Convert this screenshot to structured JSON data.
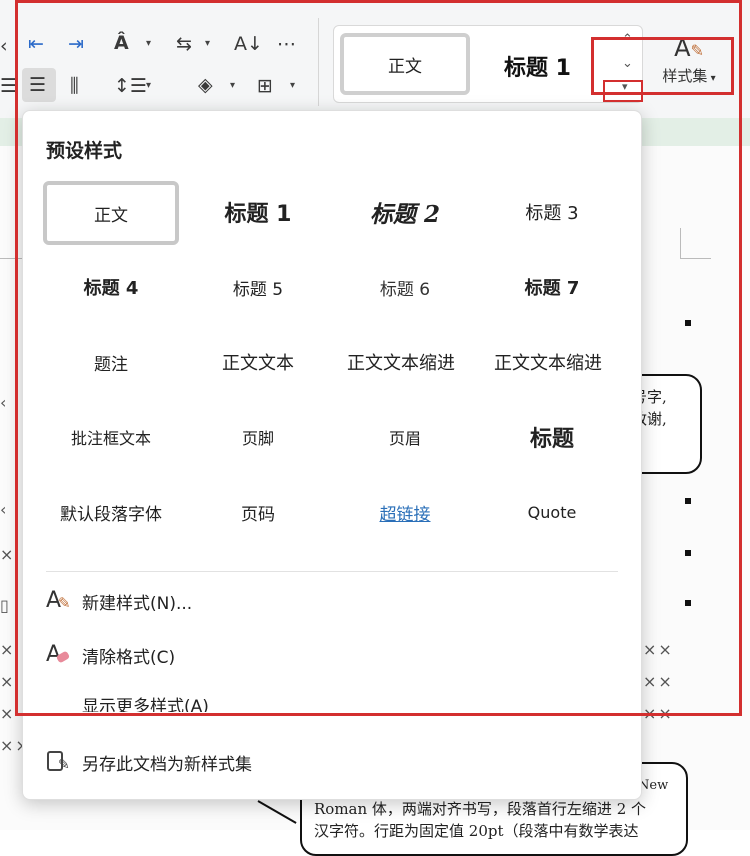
{
  "ribbon": {
    "gallery": {
      "normal_label": "正文",
      "heading1_label": "标题 1"
    },
    "style_set_label": "样式集",
    "icons": [
      "decrease-indent-icon",
      "increase-indent-icon",
      "text-direction-icon",
      "text-wrap-icon",
      "sort-icon",
      "table-border-icon",
      "align-justify-icon",
      "distributed-align-icon",
      "line-spacing-icon",
      "shading-icon",
      "borders-icon",
      "style-brush-icon",
      "gallery-up-icon",
      "gallery-down-icon",
      "gallery-more-icon"
    ]
  },
  "panel": {
    "title": "预设样式",
    "styles": [
      [
        "正文",
        "标题 1",
        "标题 2",
        "标题 3"
      ],
      [
        "标题 4",
        "标题 5",
        "标题 6",
        "标题 7"
      ],
      [
        "题注",
        "正文文本",
        "正文文本缩进",
        "正文文本缩进"
      ],
      [
        "批注框文本",
        "页脚",
        "页眉",
        "标题"
      ],
      [
        "默认段落字体",
        "页码",
        "超链接",
        "Quote"
      ]
    ],
    "menu": {
      "new_style": "新建样式(N)...",
      "clear_format": "清除格式(C)",
      "more_styles": "显示更多样式(A)",
      "save_as_set": "另存此文档为新样式集"
    }
  },
  "document": {
    "callout_right": [
      "号字,",
      "致谢,"
    ],
    "callout_bottom": {
      "line0": "New",
      "line1": "Roman 体，两端对齐书写，段落首行左缩进 2 个",
      "line2": "汉字符。行距为固定值 20pt（段落中有数学表达"
    },
    "x_marks": "××"
  },
  "colors": {
    "annotation_red": "#d32f2f",
    "hyperlink": "#2a6fb8",
    "ribbon_blue": "#2b6ac9"
  }
}
